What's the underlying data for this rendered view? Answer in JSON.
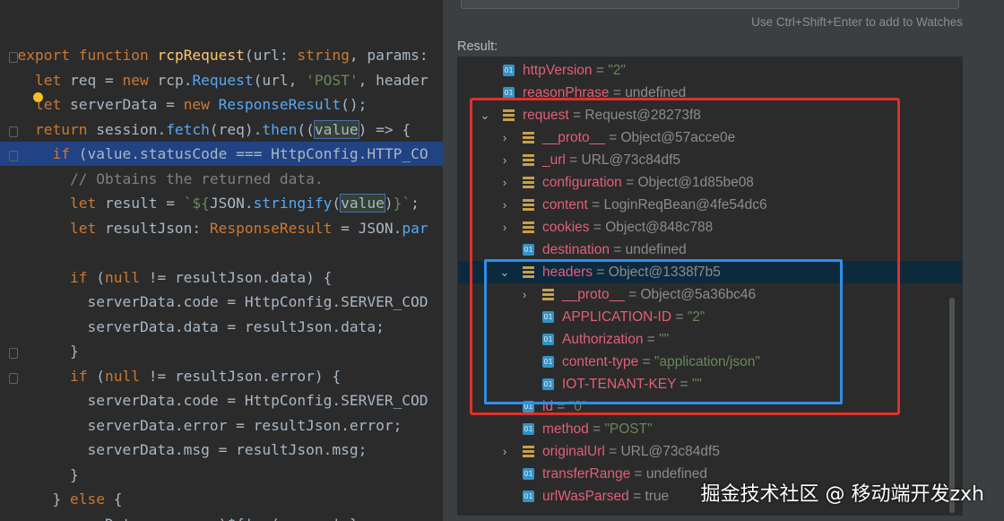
{
  "editor": {
    "lines": [
      {
        "parts": [
          [
            "kw",
            "export "
          ],
          [
            "kw",
            "function "
          ],
          [
            "fn",
            "rcpRequest"
          ],
          [
            "id",
            "(url: "
          ],
          [
            "ty",
            "string"
          ],
          [
            "id",
            ", params:"
          ]
        ]
      },
      {
        "parts": [
          [
            "kw",
            "  let "
          ],
          [
            "id",
            "req = "
          ],
          [
            "kw",
            "new "
          ],
          [
            "id",
            "rcp."
          ],
          [
            "cls",
            "Request"
          ],
          [
            "id",
            "(url, "
          ],
          [
            "str",
            "'POST'"
          ],
          [
            "id",
            ", header"
          ]
        ]
      },
      {
        "parts": [
          [
            "kw",
            "  let "
          ],
          [
            "id",
            "serverData = "
          ],
          [
            "kw",
            "new "
          ],
          [
            "cls",
            "ResponseResult"
          ],
          [
            "id",
            "();"
          ]
        ]
      },
      {
        "parts": [
          [
            "kw",
            "  return "
          ],
          [
            "id",
            "session."
          ],
          [
            "meth",
            "fetch"
          ],
          [
            "id",
            "(req)."
          ],
          [
            "meth",
            "then"
          ],
          [
            "id",
            "(("
          ],
          [
            "box",
            "value"
          ],
          [
            "id",
            ") => {"
          ]
        ]
      },
      {
        "parts": [
          [
            "kw",
            "    if "
          ],
          [
            "id",
            "(value.statusCode === HttpConfig.HTTP_CO"
          ]
        ]
      },
      {
        "parts": [
          [
            "cm",
            "      // Obtains the returned data."
          ]
        ]
      },
      {
        "parts": [
          [
            "kw",
            "      let "
          ],
          [
            "id",
            "result = "
          ],
          [
            "tmpl",
            "`${"
          ],
          [
            "id",
            "JSON."
          ],
          [
            "meth",
            "stringify"
          ],
          [
            "id",
            "("
          ],
          [
            "box",
            "value"
          ],
          [
            "id",
            ")"
          ],
          [
            "tmpl",
            "}`"
          ],
          [
            "id",
            ";"
          ]
        ]
      },
      {
        "parts": [
          [
            "kw",
            "      let "
          ],
          [
            "id",
            "resultJson: "
          ],
          [
            "ty",
            "ResponseResult"
          ],
          [
            "id",
            " = JSON."
          ],
          [
            "meth",
            "par"
          ]
        ]
      },
      {
        "parts": [
          [
            "id",
            ""
          ]
        ]
      },
      {
        "parts": [
          [
            "kw",
            "      if "
          ],
          [
            "id",
            "("
          ],
          [
            "kw",
            "null "
          ],
          [
            "id",
            "!= resultJson.data) {"
          ]
        ]
      },
      {
        "parts": [
          [
            "id",
            "        serverData.code = HttpConfig.SERVER_COD"
          ]
        ]
      },
      {
        "parts": [
          [
            "id",
            "        serverData.data = resultJson.data;"
          ]
        ]
      },
      {
        "parts": [
          [
            "id",
            "      }"
          ]
        ]
      },
      {
        "parts": [
          [
            "kw",
            "      if "
          ],
          [
            "id",
            "("
          ],
          [
            "kw",
            "null "
          ],
          [
            "id",
            "!= resultJson.error) {"
          ]
        ]
      },
      {
        "parts": [
          [
            "id",
            "        serverData.code = HttpConfig.SERVER_COD"
          ]
        ]
      },
      {
        "parts": [
          [
            "id",
            "        serverData.error = resultJson.error;"
          ]
        ]
      },
      {
        "parts": [
          [
            "id",
            "        serverData.msg = resultJson.msg;"
          ]
        ]
      },
      {
        "parts": [
          [
            "id",
            "      }"
          ]
        ]
      },
      {
        "parts": [
          [
            "id",
            "    } "
          ],
          [
            "kw",
            "else "
          ],
          [
            "id",
            "{"
          ]
        ]
      },
      {
        "parts": [
          [
            "id",
            "          Data = server)${'s (e.....' } "
          ]
        ]
      }
    ]
  },
  "panel": {
    "hint": "Use Ctrl+Shift+Enter to add to Watches",
    "result_label": "Result:",
    "rows": [
      {
        "indent": 0,
        "arrow": "",
        "icon": "field",
        "name": "httpVersion",
        "sep": " = ",
        "value": "\"2\"",
        "vstyle": "s"
      },
      {
        "indent": 0,
        "arrow": "",
        "icon": "field",
        "name": "reasonPhrase",
        "sep": " = ",
        "value": "undefined",
        "vstyle": ""
      },
      {
        "indent": 0,
        "arrow": "⌄",
        "icon": "obj",
        "name": "request",
        "sep": " = ",
        "value": "Request@28273f8",
        "vstyle": ""
      },
      {
        "indent": 1,
        "arrow": "›",
        "icon": "obj",
        "name": "__proto__",
        "sep": " = ",
        "value": "Object@57acce0e",
        "vstyle": ""
      },
      {
        "indent": 1,
        "arrow": "›",
        "icon": "obj",
        "name": "_url",
        "sep": " = ",
        "value": "URL@73c84df5",
        "vstyle": ""
      },
      {
        "indent": 1,
        "arrow": "›",
        "icon": "obj",
        "name": "configuration",
        "sep": " = ",
        "value": "Object@1d85be08",
        "vstyle": ""
      },
      {
        "indent": 1,
        "arrow": "›",
        "icon": "obj",
        "name": "content",
        "sep": " = ",
        "value": "LoginReqBean@4fe54dc6",
        "vstyle": ""
      },
      {
        "indent": 1,
        "arrow": "›",
        "icon": "obj",
        "name": "cookies",
        "sep": " = ",
        "value": "Object@848c788",
        "vstyle": ""
      },
      {
        "indent": 1,
        "arrow": "",
        "icon": "field",
        "name": "destination",
        "sep": " = ",
        "value": "undefined",
        "vstyle": ""
      },
      {
        "indent": 1,
        "arrow": "⌄",
        "icon": "obj",
        "name": "headers",
        "sep": " = ",
        "value": "Object@1338f7b5",
        "vstyle": "",
        "selected": true
      },
      {
        "indent": 2,
        "arrow": "›",
        "icon": "obj",
        "name": "__proto__",
        "sep": " = ",
        "value": "Object@5a36bc46",
        "vstyle": ""
      },
      {
        "indent": 2,
        "arrow": "",
        "icon": "field",
        "name": "APPLICATION-ID",
        "sep": " = ",
        "value": "\"2\"",
        "vstyle": "s"
      },
      {
        "indent": 2,
        "arrow": "",
        "icon": "field",
        "name": "Authorization",
        "sep": " = ",
        "value": "\"\"",
        "vstyle": "s"
      },
      {
        "indent": 2,
        "arrow": "",
        "icon": "field",
        "name": "content-type",
        "sep": " = ",
        "value": "\"application/json\"",
        "vstyle": "s"
      },
      {
        "indent": 2,
        "arrow": "",
        "icon": "field",
        "name": "IOT-TENANT-KEY",
        "sep": " = ",
        "value": "\"\"",
        "vstyle": "s"
      },
      {
        "indent": 1,
        "arrow": "",
        "icon": "field",
        "name": "id",
        "sep": " = ",
        "value": "\"0\"",
        "vstyle": "s"
      },
      {
        "indent": 1,
        "arrow": "",
        "icon": "field",
        "name": "method",
        "sep": " = ",
        "value": "\"POST\"",
        "vstyle": "s"
      },
      {
        "indent": 1,
        "arrow": "›",
        "icon": "obj",
        "name": "originalUrl",
        "sep": " = ",
        "value": "URL@73c84df5",
        "vstyle": ""
      },
      {
        "indent": 1,
        "arrow": "",
        "icon": "field",
        "name": "transferRange",
        "sep": " = ",
        "value": "undefined",
        "vstyle": ""
      },
      {
        "indent": 1,
        "arrow": "",
        "icon": "field",
        "name": "urlWasParsed",
        "sep": " = ",
        "value": "true",
        "vstyle": ""
      }
    ]
  },
  "watermark": "掘金技术社区 @ 移动端开发zxh",
  "colors": {
    "red_box": "#e0302a",
    "blue_box": "#2f8fe6",
    "field_name": "#e25f77"
  }
}
